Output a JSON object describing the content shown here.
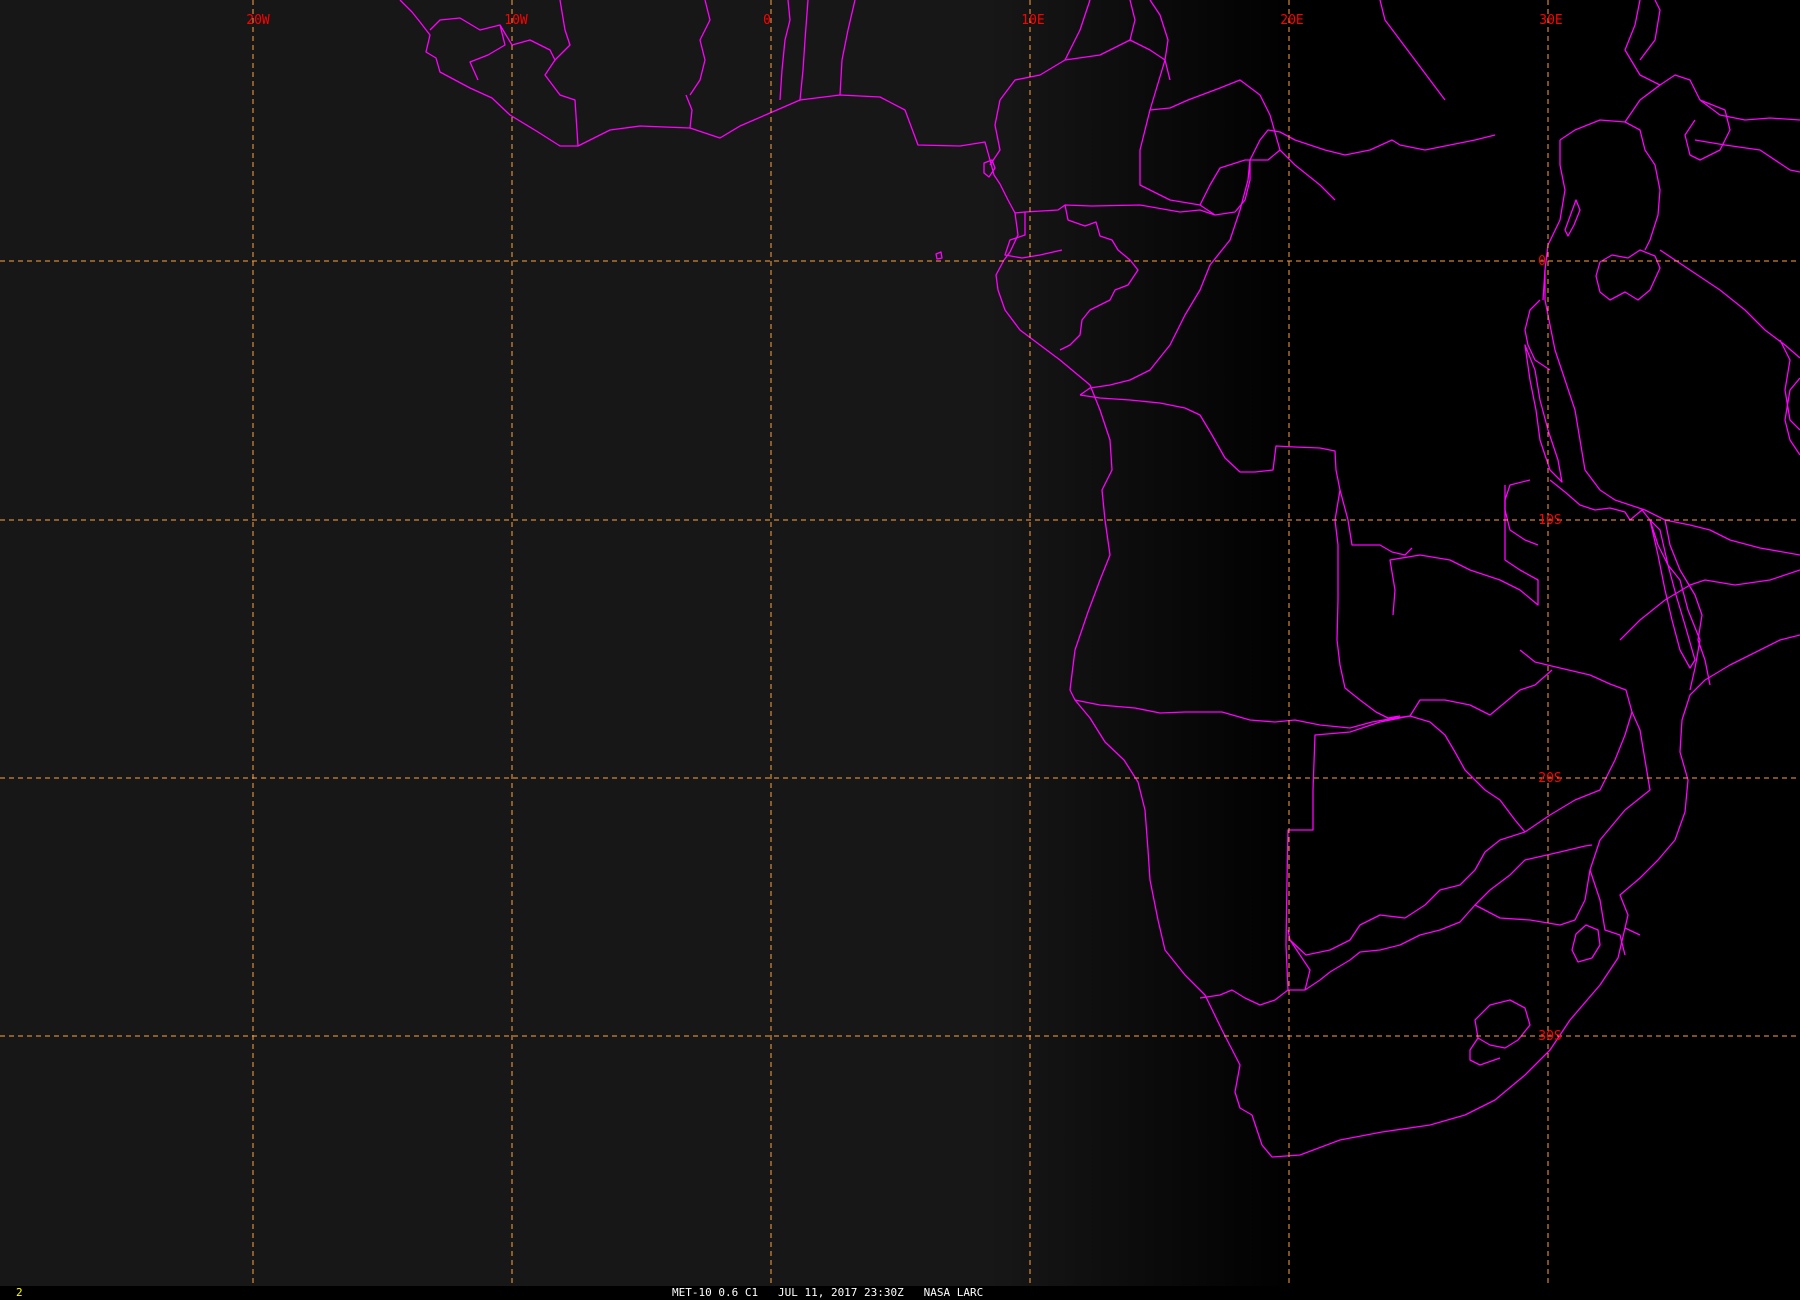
{
  "map": {
    "colors": {
      "background_west": "#171717",
      "background_east": "#000000",
      "grid_line": "#ffa040",
      "grid_label": "#ff0000",
      "boundary": "#ff00ff",
      "status_text": "#ffffff",
      "frame_number": "#ffff00"
    },
    "longitude_labels": [
      "20W",
      "10W",
      "0",
      "10E",
      "20E",
      "30E"
    ],
    "latitude_labels": [
      "0",
      "10S",
      "20S",
      "30S"
    ]
  },
  "status_bar": {
    "frame_number": "2",
    "caption": "MET-10 0.6 C1   JUL 11, 2017 23:30Z   NASA LARC"
  }
}
